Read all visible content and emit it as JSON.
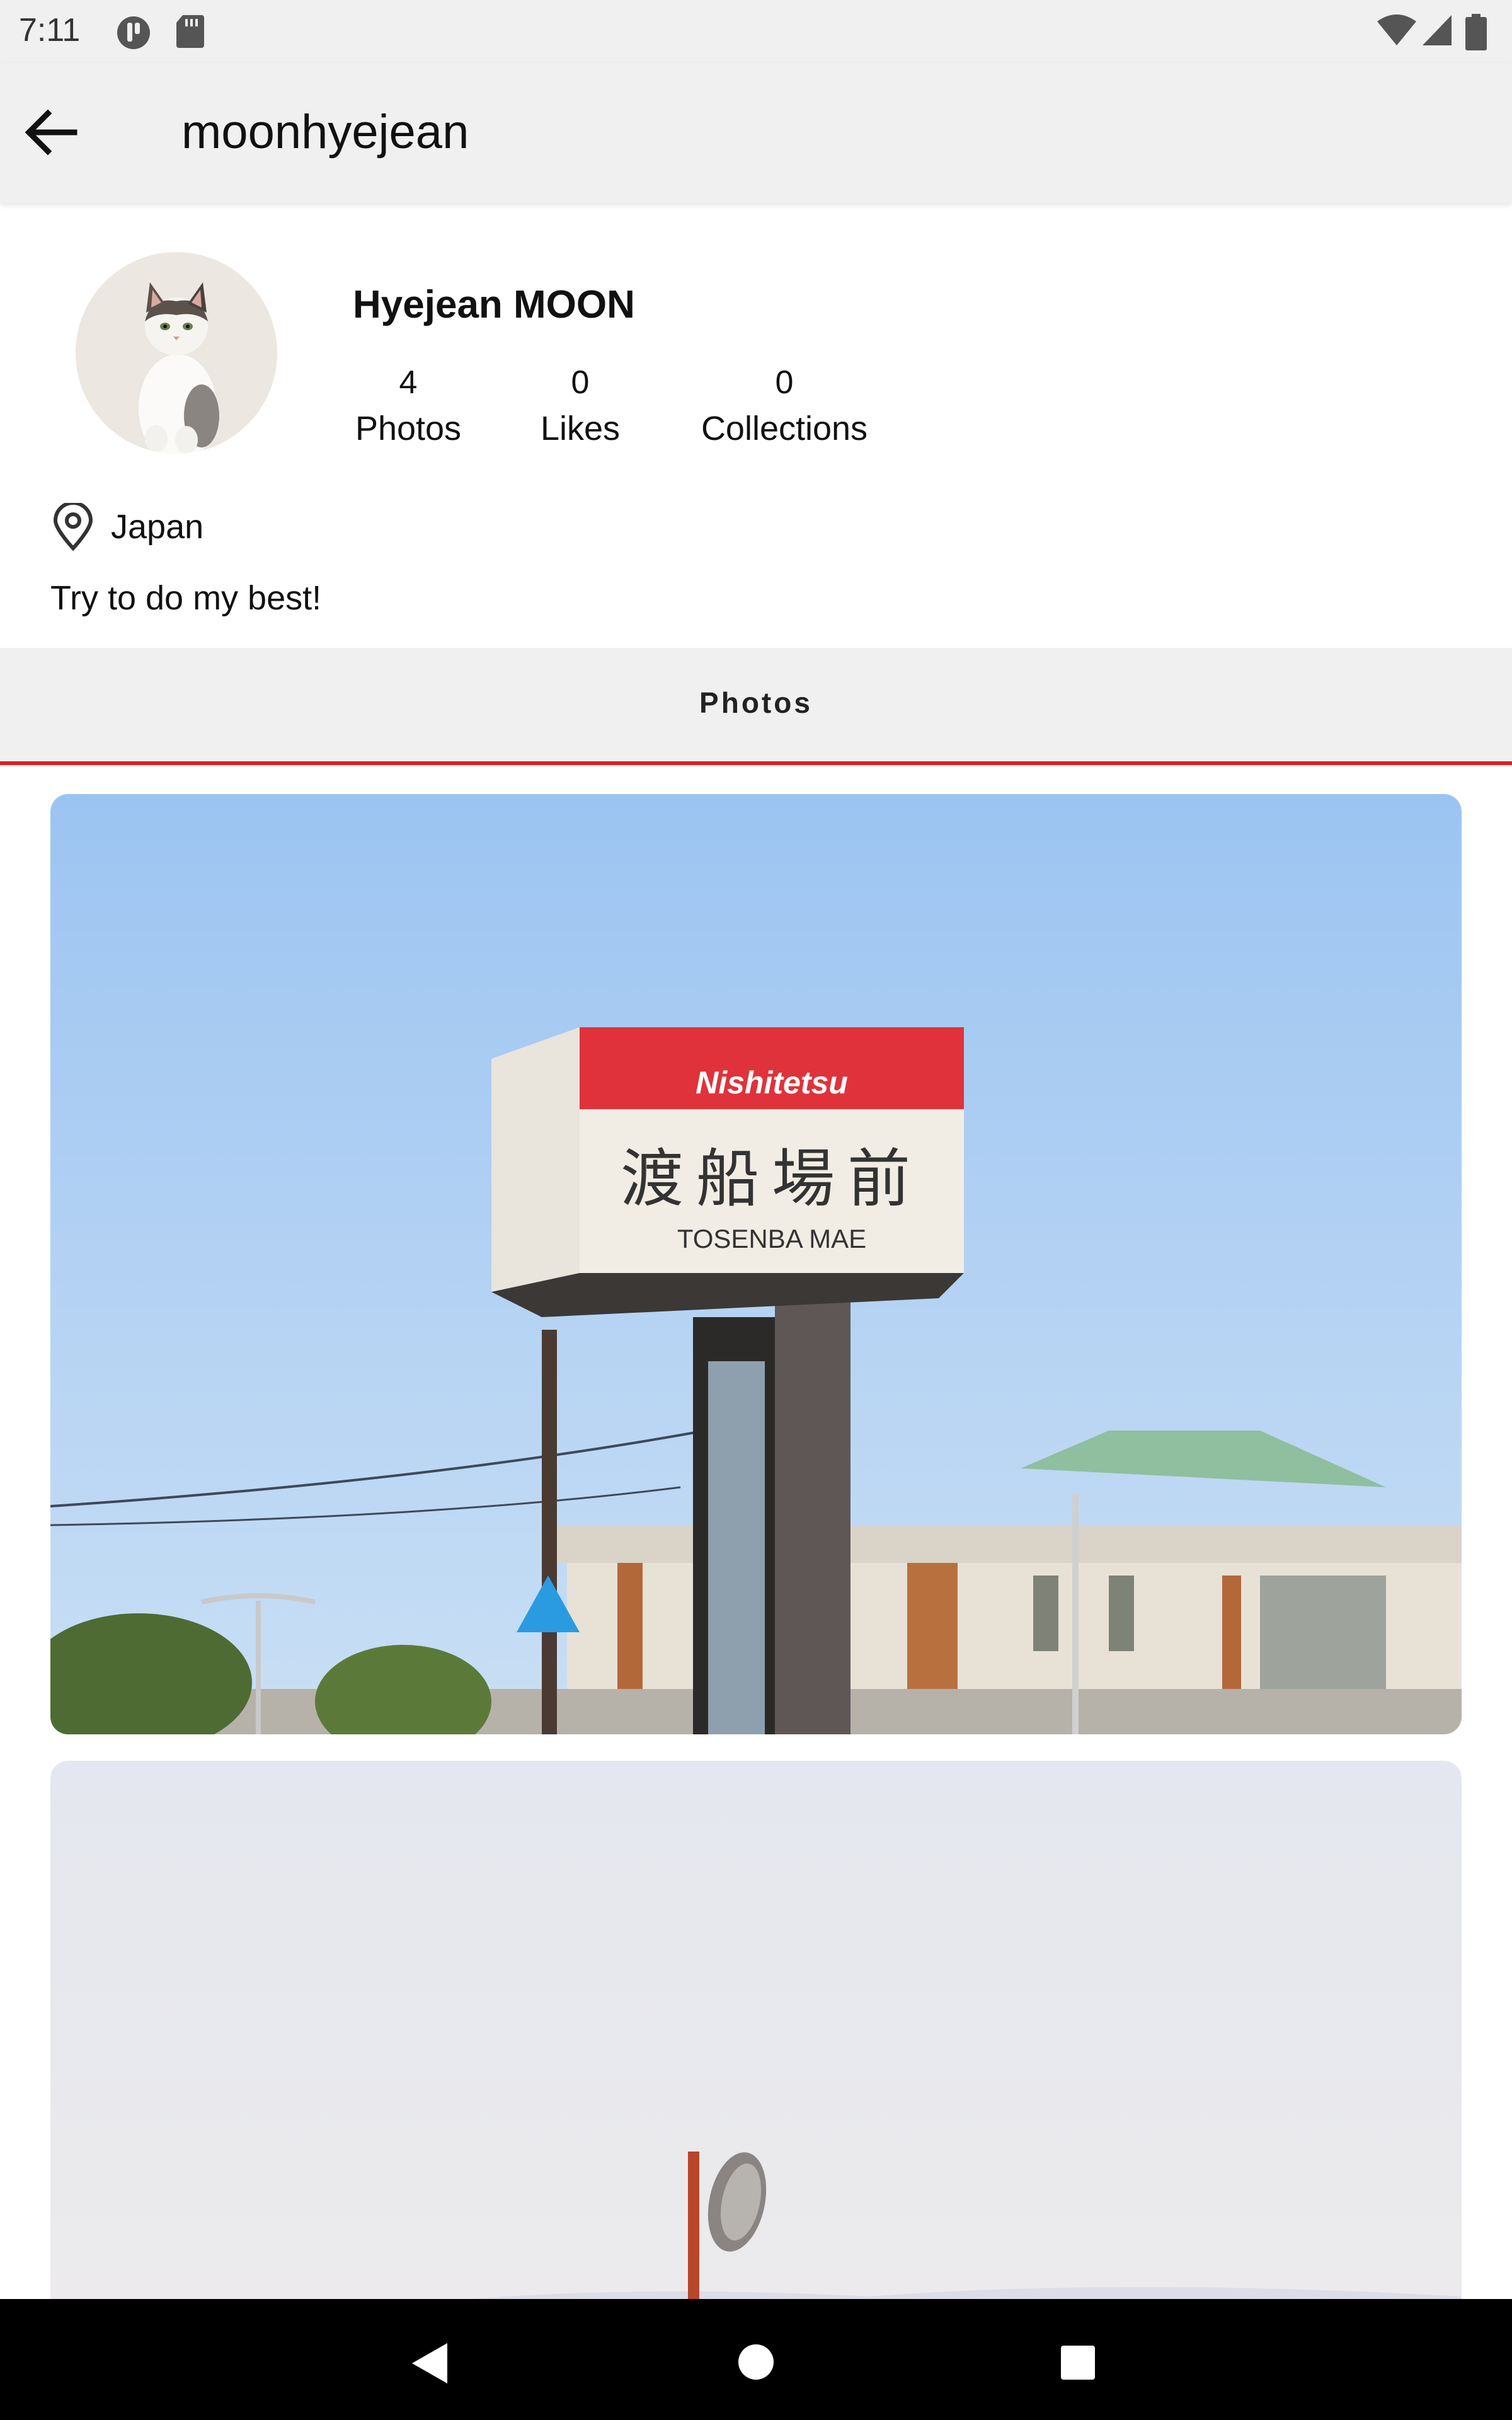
{
  "status_bar": {
    "time": "7:11"
  },
  "app_bar": {
    "title": "moonhyejean",
    "back_icon": "arrow-left-icon"
  },
  "profile": {
    "name": "Hyejean MOON",
    "stats": [
      {
        "count": "4",
        "label": "Photos"
      },
      {
        "count": "0",
        "label": "Likes"
      },
      {
        "count": "0",
        "label": "Collections"
      }
    ],
    "location": "Japan",
    "bio": "Try to do my best!"
  },
  "tabs": {
    "active_label": "Photos",
    "indicator_color": "#e31b23"
  },
  "photos": {
    "first": {
      "sign_brand": "Nishitetsu",
      "sign_kanji": "渡船場前",
      "sign_romaji": "TOSENBA MAE"
    }
  }
}
